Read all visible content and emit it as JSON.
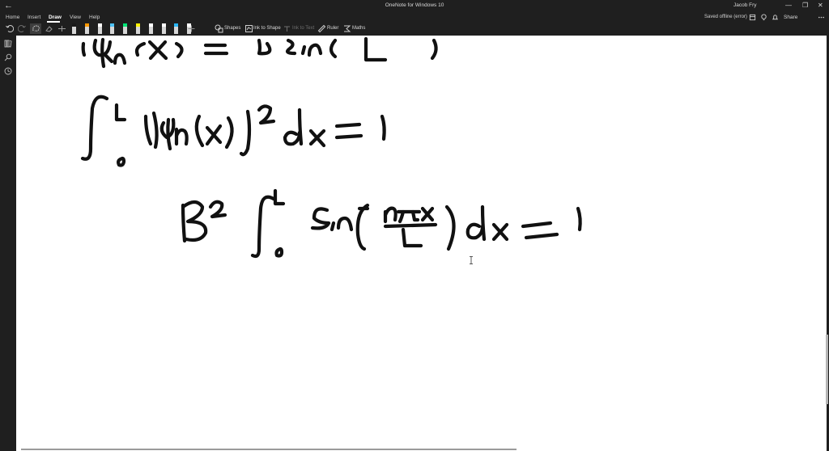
{
  "app": {
    "title": "OneNote for Windows 10",
    "back_glyph": "←",
    "user": "Jacob Fry",
    "window_controls": [
      "—",
      "❐",
      "✕"
    ]
  },
  "menu": {
    "tabs": [
      "Home",
      "Insert",
      "Draw",
      "View",
      "Help"
    ],
    "active_tab": "Draw",
    "status": "Saved offline (error)",
    "share_label": "Share"
  },
  "toolbar": {
    "undo_icon": "undo-icon",
    "redo_icon": "redo-icon",
    "pens": [
      {
        "color": "#1a1a1a"
      },
      {
        "color": "#ff9900"
      },
      {
        "color": "#ffffff"
      },
      {
        "color": "#4fc3f7"
      },
      {
        "color": "#00e676"
      },
      {
        "color": "#fff200"
      },
      {
        "color": "#ffffff"
      },
      {
        "color": "#ffffff"
      },
      {
        "color": "#29b6f6"
      },
      {
        "color": "#ffffff"
      }
    ],
    "shapes_label": "Shapes",
    "ink_to_shape_label": "Ink to Shape",
    "ink_to_text_label": "Ink to Text",
    "ruler_label": "Ruler",
    "maths_label": "Maths"
  },
  "left_nav": {
    "icons": [
      "notebooks-icon",
      "search-icon",
      "recent-icon"
    ]
  },
  "colors": {
    "chrome": "#1f1f1f",
    "canvas": "#ffffff",
    "ink": "#111111"
  }
}
